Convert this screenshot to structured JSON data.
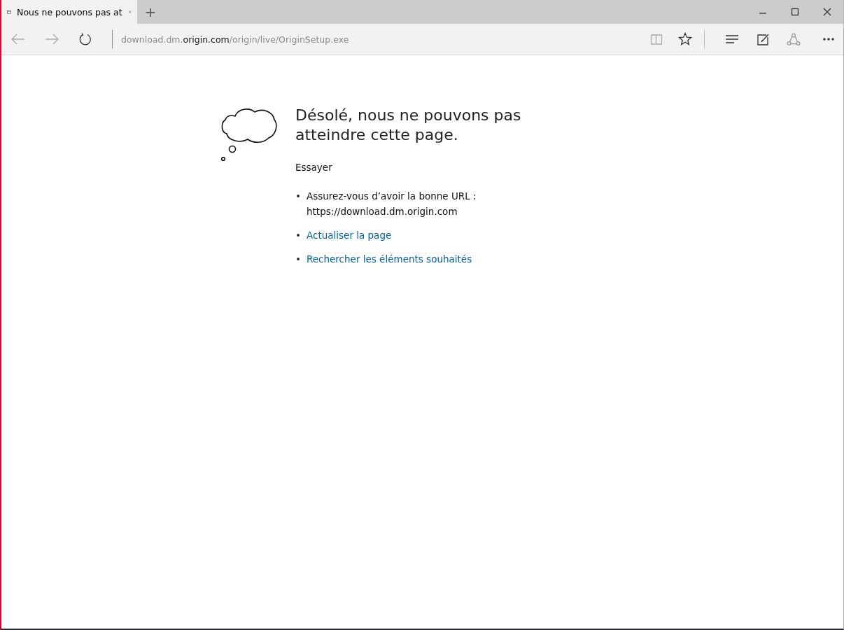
{
  "tabs": [
    {
      "title": "Nous ne pouvons pas at",
      "selected": true
    }
  ],
  "new_tab": "+",
  "address_bar": {
    "url": "download.dm.**origin.com**/origin/live/OriginSetup.exe"
  },
  "error": {
    "heading": "Désolé, nous ne pouvons pas atteindre cette page.",
    "subheading": "Essayer",
    "suggestions": [
      {
        "kind": "text",
        "lines": [
          "Assurez-vous d’avoir la bonne URL :",
          "https://download.dm.origin.com"
        ]
      },
      {
        "kind": "link",
        "lines": [
          "Actualiser la page"
        ]
      },
      {
        "kind": "link",
        "lines": [
          "Rechercher les éléments souhaités"
        ]
      }
    ]
  }
}
